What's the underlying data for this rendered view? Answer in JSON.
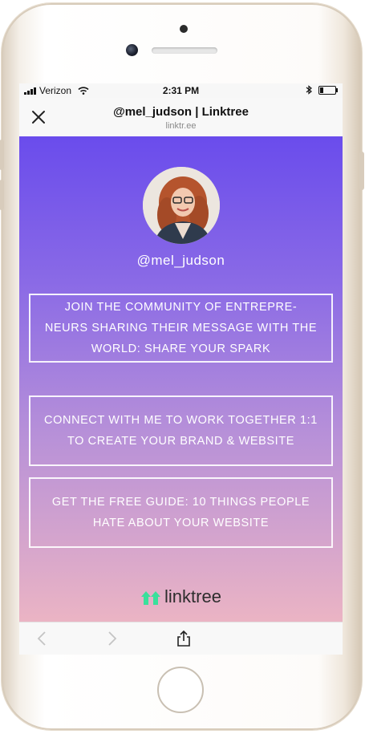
{
  "status_bar": {
    "carrier": "Verizon",
    "time": "2:31 PM",
    "battery_level": 0.2
  },
  "nav": {
    "title": "@mel_judson | Linktree",
    "url": "linktr.ee"
  },
  "profile": {
    "username": "@mel_judson"
  },
  "links": [
    {
      "label": "JOIN THE COMMUNITY OF ENTREPRE-NEURS SHARING THEIR MESSAGE WITH THE WORLD: SHARE YOUR SPARK"
    },
    {
      "label": "CONNECT WITH ME TO WORK TOGETHER 1:1 TO CREATE YOUR BRAND & WEBSITE"
    },
    {
      "label": "GET THE FREE GUIDE: 10 THINGS PEOPLE HATE ABOUT YOUR WEBSITE"
    }
  ],
  "brand": {
    "name": "linktree",
    "color": "#39e09b"
  },
  "colors": {
    "gradient_top": "#6a4cec",
    "gradient_bottom": "#ebb4c4"
  },
  "icons": {
    "close": "close-icon",
    "back": "chevron-left-icon",
    "forward": "chevron-right-icon",
    "share": "share-icon",
    "logo": "linktree-logo-icon"
  }
}
